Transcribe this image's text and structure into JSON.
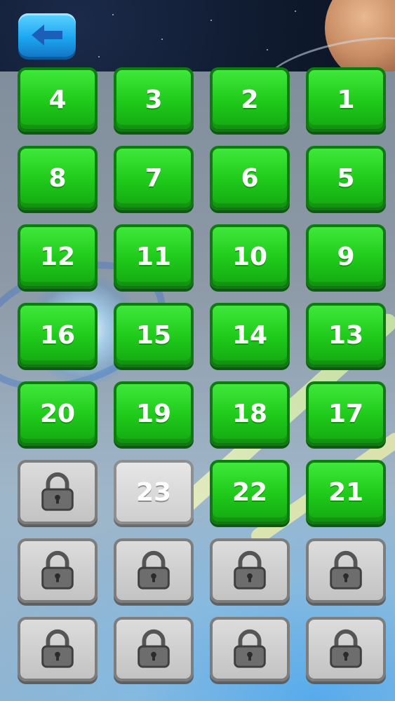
{
  "header": {
    "back_button_icon": "back-arrow-icon",
    "accent_color": "#1ea7f2"
  },
  "levels": [
    {
      "label": "4",
      "state": "open"
    },
    {
      "label": "3",
      "state": "open"
    },
    {
      "label": "2",
      "state": "open"
    },
    {
      "label": "1",
      "state": "open"
    },
    {
      "label": "8",
      "state": "open"
    },
    {
      "label": "7",
      "state": "open"
    },
    {
      "label": "6",
      "state": "open"
    },
    {
      "label": "5",
      "state": "open"
    },
    {
      "label": "12",
      "state": "open"
    },
    {
      "label": "11",
      "state": "open"
    },
    {
      "label": "10",
      "state": "open"
    },
    {
      "label": "9",
      "state": "open"
    },
    {
      "label": "16",
      "state": "open"
    },
    {
      "label": "15",
      "state": "open"
    },
    {
      "label": "14",
      "state": "open"
    },
    {
      "label": "13",
      "state": "open"
    },
    {
      "label": "20",
      "state": "open"
    },
    {
      "label": "19",
      "state": "open"
    },
    {
      "label": "18",
      "state": "open"
    },
    {
      "label": "17",
      "state": "open"
    },
    {
      "label": "",
      "state": "locked"
    },
    {
      "label": "23",
      "state": "current"
    },
    {
      "label": "22",
      "state": "open"
    },
    {
      "label": "21",
      "state": "open"
    },
    {
      "label": "",
      "state": "locked"
    },
    {
      "label": "",
      "state": "locked"
    },
    {
      "label": "",
      "state": "locked"
    },
    {
      "label": "",
      "state": "locked"
    },
    {
      "label": "",
      "state": "locked"
    },
    {
      "label": "",
      "state": "locked"
    },
    {
      "label": "",
      "state": "locked"
    },
    {
      "label": "",
      "state": "locked"
    }
  ],
  "colors": {
    "open_tile": "#1fc91a",
    "locked_tile": "#c3c3c3"
  }
}
